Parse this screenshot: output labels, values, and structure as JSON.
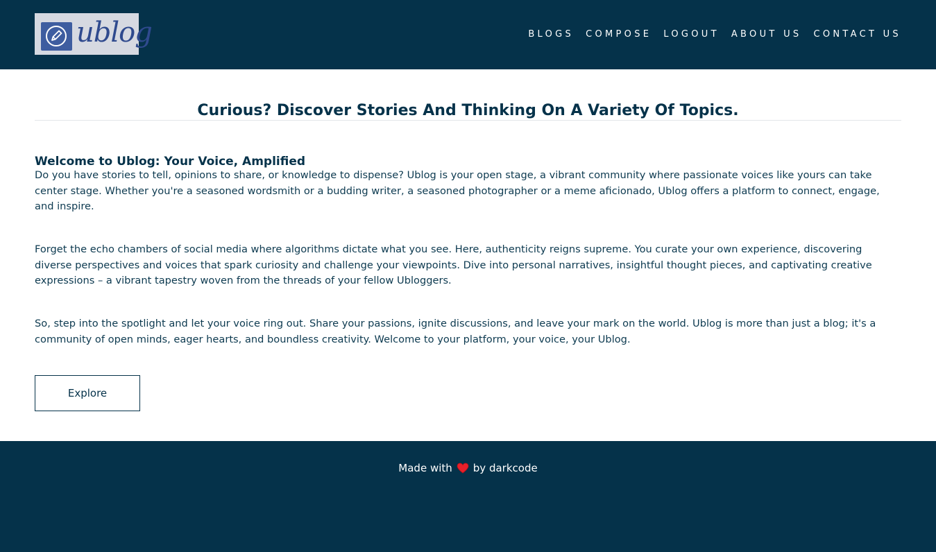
{
  "header": {
    "logo_text": "ublog",
    "logo_icon": "pencil-icon",
    "nav": [
      {
        "label": "BLOGS"
      },
      {
        "label": "COMPOSE"
      },
      {
        "label": "LOGOUT"
      },
      {
        "label": "ABOUT US"
      },
      {
        "label": "CONTACT US"
      }
    ]
  },
  "main": {
    "tagline": "Curious? Discover Stories And Thinking On A Variety Of Topics.",
    "welcome_title": "Welcome to Ublog: Your Voice, Amplified",
    "paragraphs": [
      "Do you have stories to tell, opinions to share, or knowledge to dispense? Ublog is your open stage, a vibrant community where passionate voices like yours can take center stage. Whether you're a seasoned wordsmith or a budding writer, a seasoned photographer or a meme aficionado, Ublog offers a platform to connect, engage, and inspire.",
      "Forget the echo chambers of social media where algorithms dictate what you see. Here, authenticity reigns supreme. You curate your own experience, discovering diverse perspectives and voices that spark curiosity and challenge your viewpoints. Dive into personal narratives, insightful thought pieces, and captivating creative expressions – a vibrant tapestry woven from the threads of your fellow Ubloggers.",
      "So, step into the spotlight and let your voice ring out. Share your passions, ignite discussions, and leave your mark on the world. Ublog is more than just a blog; it's a community of open minds, eager hearts, and boundless creativity. Welcome to your platform, your voice, your Ublog."
    ],
    "explore_label": "Explore"
  },
  "footer": {
    "made_with": "Made with",
    "heart_icon": "heart-icon",
    "by": "by darkcode"
  },
  "colors": {
    "brand_dark": "#05324a",
    "heart": "#e8202a",
    "logo_bg": "#d6d9e1",
    "logo_accent": "#3e5da0"
  }
}
